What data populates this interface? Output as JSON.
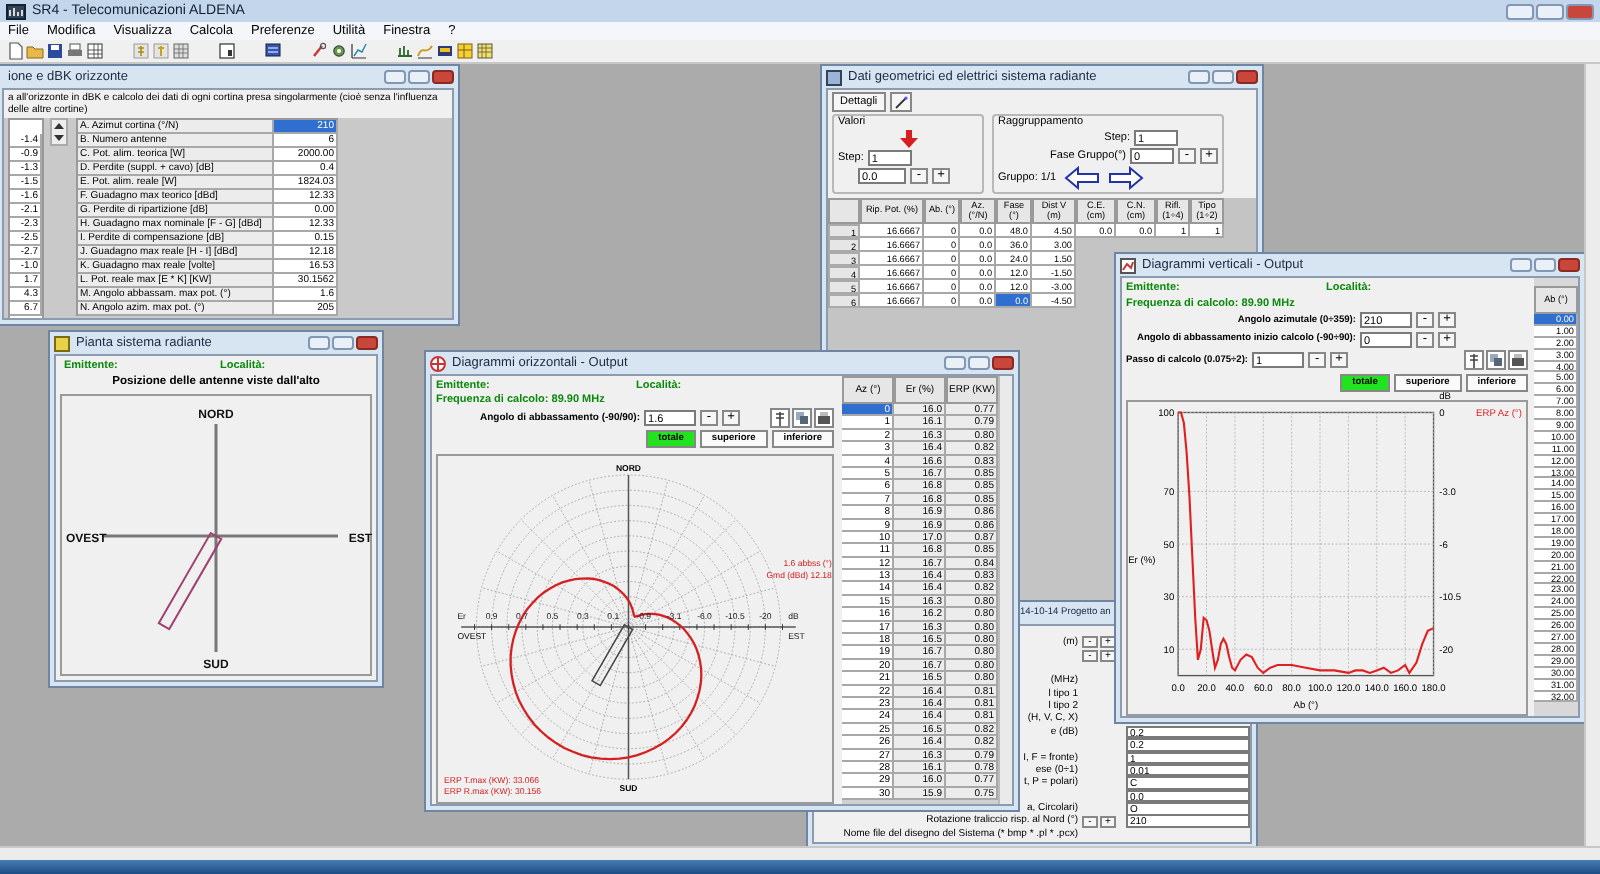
{
  "app": {
    "title": "SR4 - Telecomunicazioni ALDENA"
  },
  "menu": [
    "File",
    "Modifica",
    "Visualizza",
    "Calcola",
    "Preferenze",
    "Utilità",
    "Finestra",
    "?"
  ],
  "params_window": {
    "title": "ione e dBK orizzonte",
    "description": "a all'orizzonte in dBK e calcolo dei dati di ogni cortina presa singolarmente (cioè senza l'influenza delle altre cortine)",
    "side_values": [
      "-1.4",
      "-0.9",
      "-1.3",
      "-1.5",
      "-1.6",
      "-2.1",
      "-2.3",
      "-2.5",
      "-2.7",
      "-1.0",
      "1.7",
      "4.3",
      "6.7"
    ],
    "rows": [
      {
        "label": "A. Azimut cortina (°/N)",
        "value": "210",
        "selected": true
      },
      {
        "label": "B. Numero antenne",
        "value": "6",
        "selected": false
      },
      {
        "label": "C. Pot. alim. teorica [W]",
        "value": "2000.00",
        "selected": false
      },
      {
        "label": "D. Perdite (suppl. + cavo) [dB]",
        "value": "0.4",
        "selected": false
      },
      {
        "label": "E. Pot. alim. reale [W]",
        "value": "1824.03",
        "selected": false
      },
      {
        "label": "F. Guadagno max teorico [dBd]",
        "value": "12.33",
        "selected": false
      },
      {
        "label": "G. Perdite di ripartizione [dB]",
        "value": "0.00",
        "selected": false
      },
      {
        "label": "H. Guadagno max nominale [F - G] [dBd]",
        "value": "12.33",
        "selected": false
      },
      {
        "label": "I. Perdite di compensazione [dB]",
        "value": "0.15",
        "selected": false
      },
      {
        "label": "J. Guadagno max reale [H - I] [dBd]",
        "value": "12.18",
        "selected": false
      },
      {
        "label": "K. Guadagno max reale [volte]",
        "value": "16.53",
        "selected": false
      },
      {
        "label": "L. Pot. reale max [E * K] [KW]",
        "value": "30.1562",
        "selected": false
      },
      {
        "label": "M. Angolo abbassam. max pot. (°)",
        "value": "1.6",
        "selected": false
      },
      {
        "label": "N. Angolo azim. max pot. (°)",
        "value": "205",
        "selected": false
      }
    ]
  },
  "data_window": {
    "title": "Dati geometrici ed elettrici sistema radiante",
    "details_button": "Dettagli",
    "values_group": {
      "label": "Valori",
      "step_label": "Step:",
      "step": "1",
      "value": "0.0",
      "buttons": [
        "-",
        "+"
      ]
    },
    "grouping": {
      "label": "Raggruppamento",
      "step_label": "Step:",
      "step": "1",
      "phase_label": "Fase Gruppo(°)",
      "phase": "0",
      "buttons": [
        "-",
        "+"
      ],
      "group": "Gruppo: 1/1"
    },
    "columns": [
      "Rip. Pot. (%)",
      "Ab. (°)",
      "Az. (°/N)",
      "Fase (°)",
      "Dist V (m)",
      "C.E. (cm)",
      "C.N. (cm)",
      "Rifl. (1÷4)",
      "Tipo (1÷2)"
    ],
    "rows": [
      {
        "number": "1",
        "cells": [
          "16.6667",
          "0",
          "0.0",
          "48.0",
          "4.50",
          "0.0",
          "0.0",
          "1",
          "1"
        ],
        "selected": false
      },
      {
        "number": "2",
        "cells": [
          "16.6667",
          "0",
          "0.0",
          "36.0",
          "3.00"
        ],
        "selected": false
      },
      {
        "number": "3",
        "cells": [
          "16.6667",
          "0",
          "0.0",
          "24.0",
          "1.50"
        ],
        "selected": false
      },
      {
        "number": "4",
        "cells": [
          "16.6667",
          "0",
          "0.0",
          "12.0",
          "-1.50"
        ],
        "selected": false
      },
      {
        "number": "5",
        "cells": [
          "16.6667",
          "0",
          "0.0",
          "12.0",
          "-3.00"
        ],
        "selected": false
      },
      {
        "number": "6",
        "cells": [
          "16.6667",
          "0",
          "0.0",
          "0.0",
          "-4.50"
        ],
        "selected": true
      }
    ]
  },
  "plan_window": {
    "title": "Pianta sistema radiante",
    "station_label": "Emittente:",
    "place_label": "Località:",
    "heading": "Posizione delle antenne viste dall'alto",
    "north": "NORD",
    "south": "SUD",
    "west": "OVEST",
    "east": "EST"
  },
  "project_window": {
    "title": "14-10-14 Progetto an",
    "rows": [
      {
        "label": "(m)",
        "buttons": [
          "-",
          "+"
        ]
      },
      {
        "label": "",
        "buttons": [
          "-",
          "+"
        ]
      },
      {
        "label": ""
      },
      {
        "label": "(MHz)"
      },
      {
        "label": "l tipo 1"
      },
      {
        "label": "l tipo 2"
      },
      {
        "label": "(H, V, C, X)"
      },
      {
        "label": "e (dB)",
        "value": "0.2"
      },
      {
        "label": "",
        "value": "0.2"
      },
      {
        "label": "I, F = fronte)",
        "value": "1"
      },
      {
        "label": "ese (0÷1)",
        "value": "0.01"
      },
      {
        "label": "t, P = polari)",
        "value": "C"
      },
      {
        "label": "",
        "value": "0.0"
      },
      {
        "label": "a, Circolari)",
        "value": "O"
      },
      {
        "label": "Rotazione traliccio risp. al Nord (°)",
        "value": "210",
        "buttons": [
          "-",
          "+"
        ]
      },
      {
        "label": "Nome file del disegno del Sistema (* bmp * .pl * .pcx)"
      }
    ]
  },
  "horizontal_window": {
    "title": "Diagrammi orizzontali - Output",
    "station_label": "Emittente:",
    "place_label": "Località:",
    "frequency": "Frequenza di calcolo: 89.90 MHz",
    "angle": {
      "label": "Angolo di abbassamento (-90/90):",
      "value": "1.6",
      "buttons": [
        "-",
        "+"
      ]
    },
    "modes": [
      {
        "label": "totale",
        "selected": true
      },
      {
        "label": "superiore",
        "selected": false
      },
      {
        "label": "inferiore",
        "selected": false
      }
    ],
    "polar": {
      "north": "NORD",
      "south": "SUD",
      "west": "OVEST",
      "east": "EST",
      "left_unit": "Er",
      "right_unit": "dB",
      "left_ticks": [
        "0.9",
        "0.7",
        "0.5",
        "0.3",
        "0.1"
      ],
      "right_ticks": [
        "-0.9",
        "-3.1",
        "-6.0",
        "-10.5",
        "-20"
      ],
      "notes": [
        "1.6 abbss (°)",
        "Gmd (dBd) 12.18"
      ],
      "footer": [
        "ERP T.max (KW): 33.066",
        "ERP R.max (KW): 30.156"
      ]
    },
    "table": {
      "columns": [
        "Az (°)",
        "Er (%)",
        "ERP (KW)"
      ],
      "rows": [
        {
          "cells": [
            "0",
            "16.0",
            "0.77"
          ],
          "selected": true
        },
        {
          "cells": [
            "1",
            "16.1",
            "0.79"
          ],
          "selected": false
        },
        {
          "cells": [
            "2",
            "16.3",
            "0.80"
          ],
          "selected": false
        },
        {
          "cells": [
            "3",
            "16.4",
            "0.82"
          ],
          "selected": false
        },
        {
          "cells": [
            "4",
            "16.6",
            "0.83"
          ],
          "selected": false
        },
        {
          "cells": [
            "5",
            "16.7",
            "0.85"
          ],
          "selected": false
        },
        {
          "cells": [
            "6",
            "16.8",
            "0.85"
          ],
          "selected": false
        },
        {
          "cells": [
            "7",
            "16.8",
            "0.85"
          ],
          "selected": false
        },
        {
          "cells": [
            "8",
            "16.9",
            "0.86"
          ],
          "selected": false
        },
        {
          "cells": [
            "9",
            "16.9",
            "0.86"
          ],
          "selected": false
        },
        {
          "cells": [
            "10",
            "17.0",
            "0.87"
          ],
          "selected": false
        },
        {
          "cells": [
            "11",
            "16.8",
            "0.85"
          ],
          "selected": false
        },
        {
          "cells": [
            "12",
            "16.7",
            "0.84"
          ],
          "selected": false
        },
        {
          "cells": [
            "13",
            "16.4",
            "0.83"
          ],
          "selected": false
        },
        {
          "cells": [
            "14",
            "16.4",
            "0.82"
          ],
          "selected": false
        },
        {
          "cells": [
            "15",
            "16.3",
            "0.80"
          ],
          "selected": false
        },
        {
          "cells": [
            "16",
            "16.2",
            "0.80"
          ],
          "selected": false
        },
        {
          "cells": [
            "17",
            "16.3",
            "0.80"
          ],
          "selected": false
        },
        {
          "cells": [
            "18",
            "16.5",
            "0.80"
          ],
          "selected": false
        },
        {
          "cells": [
            "19",
            "16.7",
            "0.80"
          ],
          "selected": false
        },
        {
          "cells": [
            "20",
            "16.7",
            "0.80"
          ],
          "selected": false
        },
        {
          "cells": [
            "21",
            "16.5",
            "0.80"
          ],
          "selected": false
        },
        {
          "cells": [
            "22",
            "16.4",
            "0.81"
          ],
          "selected": false
        },
        {
          "cells": [
            "23",
            "16.4",
            "0.81"
          ],
          "selected": false
        },
        {
          "cells": [
            "24",
            "16.4",
            "0.81"
          ],
          "selected": false
        },
        {
          "cells": [
            "25",
            "16.5",
            "0.82"
          ],
          "selected": false
        },
        {
          "cells": [
            "26",
            "16.4",
            "0.82"
          ],
          "selected": false
        },
        {
          "cells": [
            "27",
            "16.3",
            "0.79"
          ],
          "selected": false
        },
        {
          "cells": [
            "28",
            "16.1",
            "0.78"
          ],
          "selected": false
        },
        {
          "cells": [
            "29",
            "16.0",
            "0.77"
          ],
          "selected": false
        },
        {
          "cells": [
            "30",
            "15.9",
            "0.75"
          ],
          "selected": false
        }
      ]
    }
  },
  "vertical_window": {
    "title": "Diagrammi verticali - Output",
    "station_label": "Emittente:",
    "place_label": "Località:",
    "frequency": "Frequenza di calcolo: 89.90 MHz",
    "fields": [
      {
        "label": "Angolo azimutale (0÷359):",
        "value": "210",
        "buttons": [
          "-",
          "+"
        ]
      },
      {
        "label": "Angolo di abbassamento inizio calcolo (-90÷90):",
        "value": "0",
        "buttons": [
          "-",
          "+"
        ]
      },
      {
        "label": "Passo di calcolo (0.075÷2):",
        "value": "1",
        "buttons": [
          "-",
          "+"
        ]
      }
    ],
    "modes": [
      {
        "label": "totale",
        "selected": true
      },
      {
        "label": "superiore",
        "selected": false
      },
      {
        "label": "inferiore",
        "selected": false
      }
    ],
    "chart_data": {
      "type": "line",
      "xlabel": "Ab (°)",
      "ylabel": "Er (%)",
      "xlim": [
        0,
        180
      ],
      "ylim": [
        0,
        100
      ],
      "xticks": [
        {
          "value": 0,
          "label": "0.0"
        },
        {
          "value": 20,
          "label": "20.0"
        },
        {
          "value": 40,
          "label": "40.0"
        },
        {
          "value": 60,
          "label": "60.0"
        },
        {
          "value": 80,
          "label": "80.0"
        },
        {
          "value": 100,
          "label": "100.0"
        },
        {
          "value": 120,
          "label": "120.0"
        },
        {
          "value": 140,
          "label": "140.0"
        },
        {
          "value": 160,
          "label": "160.0"
        },
        {
          "value": 180,
          "label": "180.0"
        }
      ],
      "yticks": [
        100,
        70,
        50,
        30,
        10
      ],
      "grid": true,
      "x": [
        0,
        2,
        4,
        6,
        8,
        10,
        12,
        14,
        16,
        18,
        20,
        22,
        24,
        26,
        28,
        30,
        32,
        34,
        36,
        38,
        40,
        44,
        48,
        52,
        56,
        60,
        65,
        70,
        80,
        90,
        100,
        110,
        120,
        125,
        130,
        135,
        140,
        145,
        150,
        155,
        160,
        163,
        168,
        172,
        176,
        180
      ],
      "series": [
        {
          "name": "ERP Az (°)",
          "color": "#e02020",
          "values": [
            100,
            100,
            96,
            85,
            68,
            45,
            22,
            6,
            10,
            22,
            21,
            17,
            10,
            3,
            6,
            12,
            14,
            12,
            7,
            3,
            2,
            6,
            8,
            7,
            3,
            1,
            3,
            4,
            4,
            3,
            2,
            2,
            1,
            2,
            2,
            1,
            2,
            3,
            1,
            2,
            4,
            1,
            5,
            12,
            17,
            18
          ]
        }
      ]
    },
    "right_axis": {
      "unit": "dB",
      "ticks": [
        "0",
        "-3.0",
        "-6",
        "-10.5",
        "-20"
      ]
    },
    "table": {
      "header": "Ab (°)",
      "rows": [
        {
          "value": "0.00",
          "selected": true
        },
        {
          "value": "1.00",
          "selected": false
        },
        {
          "value": "2.00",
          "selected": false
        },
        {
          "value": "3.00",
          "selected": false
        },
        {
          "value": "4.00",
          "selected": false
        },
        {
          "value": "5.00",
          "selected": false
        },
        {
          "value": "6.00",
          "selected": false
        },
        {
          "value": "7.00",
          "selected": false
        },
        {
          "value": "8.00",
          "selected": false
        },
        {
          "value": "9.00",
          "selected": false
        },
        {
          "value": "10.00",
          "selected": false
        },
        {
          "value": "11.00",
          "selected": false
        },
        {
          "value": "12.00",
          "selected": false
        },
        {
          "value": "13.00",
          "selected": false
        },
        {
          "value": "14.00",
          "selected": false
        },
        {
          "value": "15.00",
          "selected": false
        },
        {
          "value": "16.00",
          "selected": false
        },
        {
          "value": "17.00",
          "selected": false
        },
        {
          "value": "18.00",
          "selected": false
        },
        {
          "value": "19.00",
          "selected": false
        },
        {
          "value": "20.00",
          "selected": false
        },
        {
          "value": "21.00",
          "selected": false
        },
        {
          "value": "22.00",
          "selected": false
        },
        {
          "value": "23.00",
          "selected": false
        },
        {
          "value": "24.00",
          "selected": false
        },
        {
          "value": "25.00",
          "selected": false
        },
        {
          "value": "26.00",
          "selected": false
        },
        {
          "value": "27.00",
          "selected": false
        },
        {
          "value": "28.00",
          "selected": false
        },
        {
          "value": "29.00",
          "selected": false
        },
        {
          "value": "30.00",
          "selected": false
        },
        {
          "value": "31.00",
          "selected": false
        },
        {
          "value": "32.00",
          "selected": false
        }
      ]
    }
  }
}
